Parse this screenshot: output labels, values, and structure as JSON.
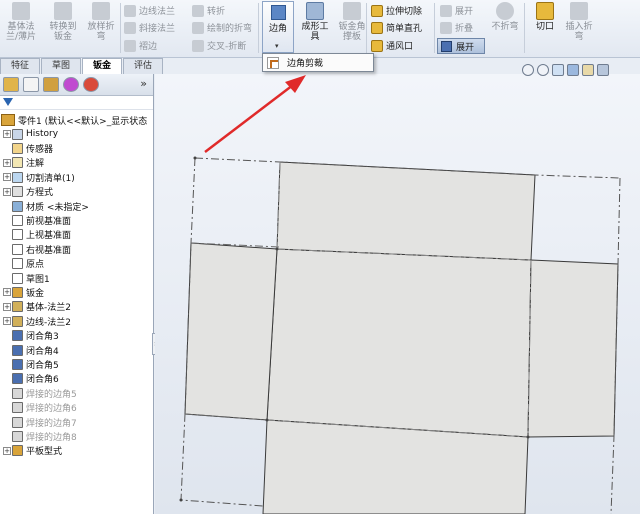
{
  "ribbon": {
    "base_flange": "基体法\n兰/薄片",
    "convert_to_sheet": "转换到\n钣金",
    "lofted_bend": "放样折\n弯",
    "edge_flange": "边线法兰",
    "miter_flange": "斜接法兰",
    "hem": "褶边",
    "jog": "转折",
    "sketched_bend": "绘制的折弯",
    "cross_break": "交叉-折断",
    "corner": "边角",
    "forming_tool": "成形工\n具",
    "sheet_gusset": "钣金角\n撑板",
    "extruded_cut": "拉伸切除",
    "simple_hole": "简单直孔",
    "vent": "通风口",
    "unfold": "展开",
    "fold": "折叠",
    "flatten": "展开",
    "no_bends": "不折弯",
    "rip": "切口",
    "insert_bends": "插入折\n弯"
  },
  "dropdown": {
    "item": "边角剪裁"
  },
  "tabs": [
    "特征",
    "草图",
    "钣金",
    "评估"
  ],
  "tree": {
    "root": "零件1 (默认<<默认>_显示状态",
    "items": [
      {
        "label": "History",
        "expand": "+",
        "color": "#c9d6e8",
        "dim": false
      },
      {
        "label": "传感器",
        "expand": "",
        "color": "#f2d48a",
        "dim": false
      },
      {
        "label": "注解",
        "expand": "+",
        "color": "#f3e7b3",
        "dim": false
      },
      {
        "label": "切割清单(1)",
        "expand": "+",
        "color": "#bcd7f0",
        "dim": false
      },
      {
        "label": "方程式",
        "expand": "+",
        "color": "#e0e0e0",
        "dim": false
      },
      {
        "label": "材质 <未指定>",
        "expand": "",
        "color": "#8ab0d8",
        "dim": false
      },
      {
        "label": "前视基准面",
        "expand": "",
        "color": "#ffffff",
        "dim": false
      },
      {
        "label": "上视基准面",
        "expand": "",
        "color": "#ffffff",
        "dim": false
      },
      {
        "label": "右视基准面",
        "expand": "",
        "color": "#ffffff",
        "dim": false
      },
      {
        "label": "原点",
        "expand": "",
        "color": "#ffffff",
        "dim": false
      },
      {
        "label": "草图1",
        "expand": "",
        "color": "#ffffff",
        "dim": false
      },
      {
        "label": "钣金",
        "expand": "+",
        "color": "#d9a43a",
        "dim": false
      },
      {
        "label": "基体-法兰2",
        "expand": "+",
        "color": "#d1b05a",
        "dim": false
      },
      {
        "label": "边线-法兰2",
        "expand": "+",
        "color": "#d1b05a",
        "dim": false
      },
      {
        "label": "闭合角3",
        "expand": "",
        "color": "#4a6fb0",
        "dim": false
      },
      {
        "label": "闭合角4",
        "expand": "",
        "color": "#4a6fb0",
        "dim": false
      },
      {
        "label": "闭合角5",
        "expand": "",
        "color": "#4a6fb0",
        "dim": false
      },
      {
        "label": "闭合角6",
        "expand": "",
        "color": "#4a6fb0",
        "dim": false
      },
      {
        "label": "焊接的边角5",
        "expand": "",
        "color": "#d8d8d8",
        "dim": true
      },
      {
        "label": "焊接的边角6",
        "expand": "",
        "color": "#d8d8d8",
        "dim": true
      },
      {
        "label": "焊接的边角7",
        "expand": "",
        "color": "#d8d8d8",
        "dim": true
      },
      {
        "label": "焊接的边角8",
        "expand": "",
        "color": "#d8d8d8",
        "dim": true
      },
      {
        "label": "平板型式",
        "expand": "+",
        "color": "#d9a43a",
        "dim": false
      }
    ]
  },
  "colors": {
    "accent": "#2f5791",
    "annotation_arrow": "#e02a2a",
    "sheet_fill": "#e3e3e1",
    "sheet_edge": "#3a3a3a"
  },
  "icons": [
    "corner-icon",
    "corner-trim-icon",
    "filter-icon",
    "view-zoom-icon"
  ]
}
